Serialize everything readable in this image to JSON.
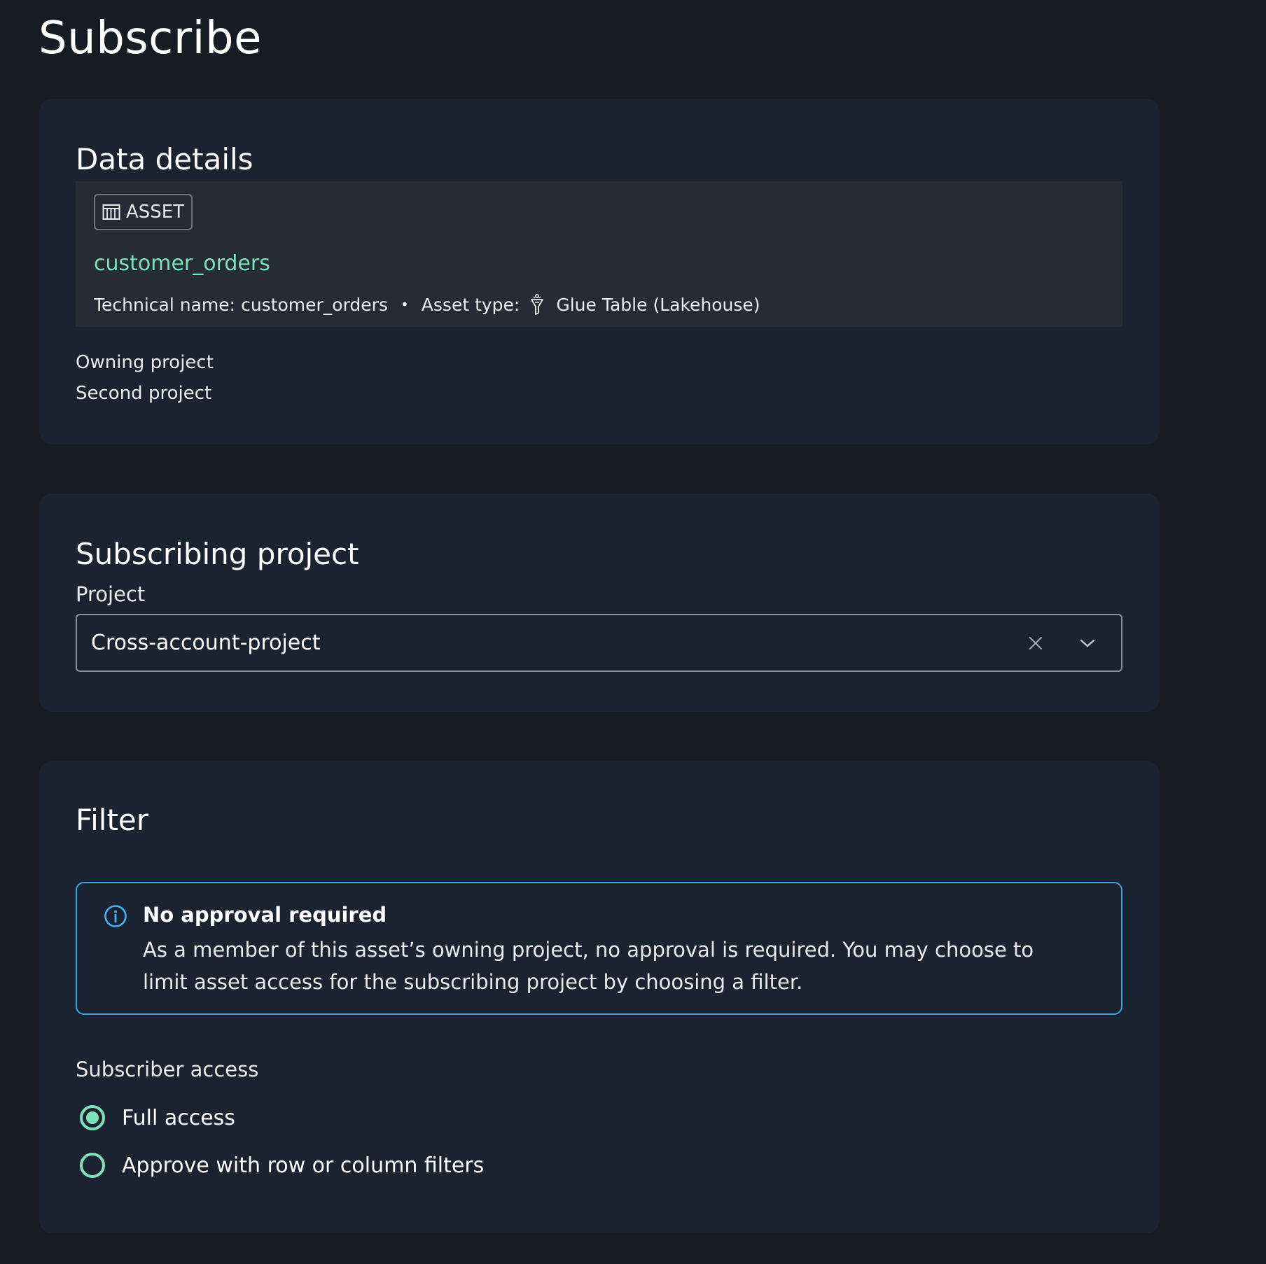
{
  "page": {
    "title": "Subscribe"
  },
  "data_details": {
    "heading": "Data details",
    "badge_icon": "table-icon",
    "badge_label": "ASSET",
    "asset_name": "customer_orders",
    "technical_name_label": "Technical name:",
    "technical_name_value": "customer_orders",
    "separator": "•",
    "asset_type_label": "Asset type:",
    "asset_type_icon": "glue-icon",
    "asset_type_value": "Glue Table (Lakehouse)",
    "owning_project_label": "Owning project",
    "owning_project_value": "Second project"
  },
  "subscribing_project": {
    "heading": "Subscribing project",
    "project_label": "Project",
    "project_value": "Cross-account-project",
    "clear_icon": "close-icon",
    "toggle_icon": "chevron-down-icon"
  },
  "filter": {
    "heading": "Filter",
    "alert": {
      "icon": "info-icon",
      "title": "No approval required",
      "body": "As a member of this asset’s owning project, no approval is required. You may choose to limit asset access for the subscribing project by choosing a filter."
    },
    "subscriber_access_label": "Subscriber access",
    "options": [
      {
        "label": "Full access",
        "selected": true
      },
      {
        "label": "Approve with row or column filters",
        "selected": false
      }
    ]
  },
  "colors": {
    "background": "#161b24",
    "panel": "#1c2330",
    "card": "#262c35",
    "accent_green": "#7ee2b8",
    "info_blue": "#2ea8e6"
  }
}
